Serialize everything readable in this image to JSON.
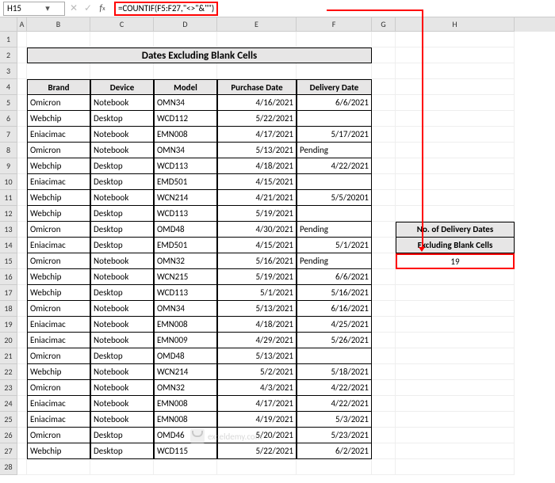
{
  "namebox": "H15",
  "formula": "=COUNTIF(F5:F27,\"<>\"&\"\")",
  "title": "Dates Excluding Blank Cells",
  "columns": [
    "A",
    "B",
    "C",
    "D",
    "E",
    "F",
    "G",
    "H"
  ],
  "rows": [
    "1",
    "2",
    "3",
    "4",
    "5",
    "6",
    "7",
    "8",
    "9",
    "10",
    "11",
    "12",
    "13",
    "14",
    "15",
    "16",
    "17",
    "18",
    "19",
    "20",
    "21",
    "22",
    "23",
    "24",
    "25",
    "26",
    "27",
    "28"
  ],
  "headers": {
    "B": "Brand",
    "C": "Device",
    "D": "Model",
    "E": "Purchase Date",
    "F": "Delivery Date"
  },
  "data": [
    {
      "B": "Omicron",
      "C": "Notebook",
      "D": "OMN34",
      "E": "4/16/2021",
      "F": "6/6/2021"
    },
    {
      "B": "Webchip",
      "C": "Desktop",
      "D": "WCD112",
      "E": "5/22/2021",
      "F": ""
    },
    {
      "B": "Eniacimac",
      "C": "Notebook",
      "D": "EMN008",
      "E": "4/17/2021",
      "F": "5/17/2021"
    },
    {
      "B": "Omicron",
      "C": "Notebook",
      "D": "OMN34",
      "E": "5/13/2021",
      "F": "Pending"
    },
    {
      "B": "Webchip",
      "C": "Desktop",
      "D": "WCD113",
      "E": "4/18/2021",
      "F": "4/22/2021"
    },
    {
      "B": "Eniacimac",
      "C": "Desktop",
      "D": "EMD501",
      "E": "4/15/2021",
      "F": ""
    },
    {
      "B": "Webchip",
      "C": "Notebook",
      "D": "WCN214",
      "E": "4/21/2021",
      "F": "5/5/20201"
    },
    {
      "B": "Webchip",
      "C": "Desktop",
      "D": "WCD113",
      "E": "5/19/2021",
      "F": ""
    },
    {
      "B": "Omicron",
      "C": "Desktop",
      "D": "OMD48",
      "E": "4/30/2021",
      "F": "Pending"
    },
    {
      "B": "Eniacimac",
      "C": "Desktop",
      "D": "EMD501",
      "E": "4/15/2021",
      "F": "5/1/2021"
    },
    {
      "B": "Omicron",
      "C": "Notebook",
      "D": "OMN32",
      "E": "5/16/2021",
      "F": "Pending"
    },
    {
      "B": "Webchip",
      "C": "Notebook",
      "D": "WCN215",
      "E": "5/19/2021",
      "F": "6/6/2021"
    },
    {
      "B": "Webchip",
      "C": "Desktop",
      "D": "WCD113",
      "E": "5/1/2021",
      "F": "5/16/2021"
    },
    {
      "B": "Omicron",
      "C": "Notebook",
      "D": "OMN34",
      "E": "5/13/2021",
      "F": "6/16/2021"
    },
    {
      "B": "Eniacimac",
      "C": "Notebook",
      "D": "EMN008",
      "E": "4/18/2021",
      "F": "4/25/2021"
    },
    {
      "B": "Eniacimac",
      "C": "Notebook",
      "D": "EMN009",
      "E": "4/29/2021",
      "F": "5/26/2021"
    },
    {
      "B": "Omicron",
      "C": "Desktop",
      "D": "OMD48",
      "E": "5/13/2021",
      "F": ""
    },
    {
      "B": "Webchip",
      "C": "Notebook",
      "D": "WCN214",
      "E": "5/2/2021",
      "F": "5/18/2021"
    },
    {
      "B": "Omicron",
      "C": "Notebook",
      "D": "OMN32",
      "E": "4/3/2021",
      "F": "4/22/2021"
    },
    {
      "B": "Eniacimac",
      "C": "Notebook",
      "D": "EMN008",
      "E": "4/17/2021",
      "F": "4/22/2021"
    },
    {
      "B": "Eniacimac",
      "C": "Notebook",
      "D": "EMN008",
      "E": "4/19/2021",
      "F": "5/3/2021"
    },
    {
      "B": "Omicron",
      "C": "Desktop",
      "D": "OMD46",
      "E": "5/20/2021",
      "F": "5/23/2021"
    },
    {
      "B": "Webchip",
      "C": "Desktop",
      "D": "WCD115",
      "E": "5/22/2021",
      "F": "6/2/2021"
    }
  ],
  "side": {
    "head1": "No. of Delivery Dates",
    "head2": "Excluding Blank Cells",
    "result": "19"
  },
  "watermark": "exceldemy.com"
}
